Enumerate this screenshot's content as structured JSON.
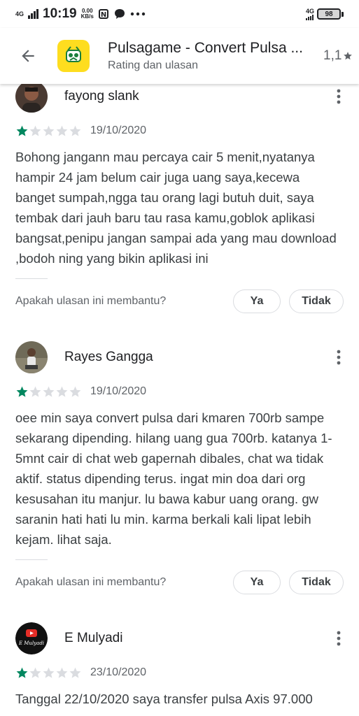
{
  "status_bar": {
    "network": "4G",
    "time": "10:19",
    "speed_value": "0.00",
    "speed_unit": "KB/s",
    "right_network": "4G",
    "battery": "98"
  },
  "app_bar": {
    "title": "Pulsagame - Convert Pulsa ...",
    "subtitle": "Rating dan ulasan",
    "rating": "1,1"
  },
  "reviews": [
    {
      "name": "fayong slank",
      "stars": 1,
      "date": "19/10/2020",
      "text": "Bohong jangann mau percaya cair 5 menit,nyatanya hampir 24 jam belum cair juga uang saya,kecewa banget sumpah,ngga tau orang lagi butuh duit, saya tembak dari jauh baru tau rasa kamu,goblok aplikasi bangsat,penipu jangan sampai ada yang mau download ,bodoh ning yang bikin aplikasi ini",
      "helpful_question": "Apakah ulasan ini membantu?",
      "yes_label": "Ya",
      "no_label": "Tidak"
    },
    {
      "name": "Rayes Gangga",
      "stars": 1,
      "date": "19/10/2020",
      "text": "oee min saya convert pulsa dari kmaren 700rb sampe sekarang dipending. hilang uang gua 700rb. katanya 1-5mnt cair di chat web gapernah dibales, chat wa tidak aktif. status dipending terus. ingat min doa dari org kesusahan itu manjur. lu bawa kabur uang orang. gw saranin hati hati lu min. karma berkali kali lipat lebih kejam. lihat saja.",
      "helpful_question": "Apakah ulasan ini membantu?",
      "yes_label": "Ya",
      "no_label": "Tidak"
    },
    {
      "name": "E Mulyadi",
      "stars": 1,
      "date": "23/10/2020",
      "text": "Tanggal 22/10/2020 saya transfer pulsa Axis 97.000"
    }
  ],
  "colors": {
    "star_filled": "#01875f",
    "star_empty": "#dadce0",
    "app_icon_bg": "#fedd1f"
  }
}
